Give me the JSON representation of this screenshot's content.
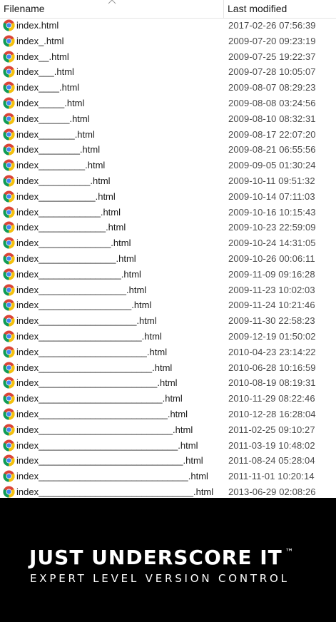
{
  "explorer": {
    "columns": {
      "filename": "Filename",
      "last_modified": "Last modified"
    },
    "file_icon": "chrome-browser-icon",
    "files": [
      {
        "name": "index.html",
        "modified": "2017-02-26 07:56:39"
      },
      {
        "name": "index_.html",
        "modified": "2009-07-20 09:23:19"
      },
      {
        "name": "index__.html",
        "modified": "2009-07-25 19:22:37"
      },
      {
        "name": "index___.html",
        "modified": "2009-07-28 10:05:07"
      },
      {
        "name": "index____.html",
        "modified": "2009-08-07 08:29:23"
      },
      {
        "name": "index_____.html",
        "modified": "2009-08-08 03:24:56"
      },
      {
        "name": "index______.html",
        "modified": "2009-08-10 08:32:31"
      },
      {
        "name": "index_______.html",
        "modified": "2009-08-17 22:07:20"
      },
      {
        "name": "index________.html",
        "modified": "2009-08-21 06:55:56"
      },
      {
        "name": "index_________.html",
        "modified": "2009-09-05 01:30:24"
      },
      {
        "name": "index__________.html",
        "modified": "2009-10-11 09:51:32"
      },
      {
        "name": "index___________.html",
        "modified": "2009-10-14 07:11:03"
      },
      {
        "name": "index____________.html",
        "modified": "2009-10-16 10:15:43"
      },
      {
        "name": "index_____________.html",
        "modified": "2009-10-23 22:59:09"
      },
      {
        "name": "index______________.html",
        "modified": "2009-10-24 14:31:05"
      },
      {
        "name": "index_______________.html",
        "modified": "2009-10-26 00:06:11"
      },
      {
        "name": "index________________.html",
        "modified": "2009-11-09 09:16:28"
      },
      {
        "name": "index_________________.html",
        "modified": "2009-11-23 10:02:03"
      },
      {
        "name": "index__________________.html",
        "modified": "2009-11-24 10:21:46"
      },
      {
        "name": "index___________________.html",
        "modified": "2009-11-30 22:58:23"
      },
      {
        "name": "index____________________.html",
        "modified": "2009-12-19 01:50:02"
      },
      {
        "name": "index_____________________.html",
        "modified": "2010-04-23 23:14:22"
      },
      {
        "name": "index______________________.html",
        "modified": "2010-06-28 10:16:59"
      },
      {
        "name": "index_______________________.html",
        "modified": "2010-08-19 08:19:31"
      },
      {
        "name": "index________________________.html",
        "modified": "2010-11-29 08:22:46"
      },
      {
        "name": "index_________________________.html",
        "modified": "2010-12-28 16:28:04"
      },
      {
        "name": "index__________________________.html",
        "modified": "2011-02-25 09:10:27"
      },
      {
        "name": "index___________________________.html",
        "modified": "2011-03-19 10:48:02"
      },
      {
        "name": "index____________________________.html",
        "modified": "2011-08-24 05:28:04"
      },
      {
        "name": "index_____________________________.html",
        "modified": "2011-11-01 10:20:14"
      },
      {
        "name": "index______________________________.html",
        "modified": "2013-06-29 02:08:26"
      }
    ]
  },
  "caption": {
    "title": "JUST UNDERSCORE IT",
    "trademark": "™",
    "subtitle": "EXPERT LEVEL VERSION CONTROL"
  }
}
